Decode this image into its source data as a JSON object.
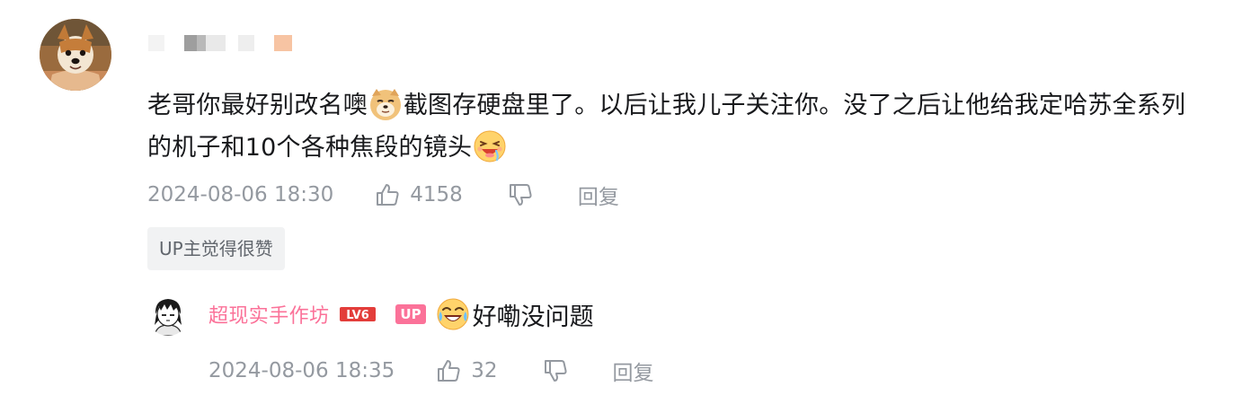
{
  "comment": {
    "text_part1": "老哥你最好别改名噢",
    "emoji1": "doge-emoji",
    "text_part2": "截图存硬盘里了。以后让我儿子关注你。没了之后让他给我定哈苏全系列的机子和10个各种焦段的镜头",
    "emoji2": "drooling-face-emoji",
    "timestamp": "2024-08-06 18:30",
    "like_count": "4158",
    "reply_label": "回复",
    "up_liked_tag": "UP主觉得很赞"
  },
  "reply": {
    "username": "超现实手作坊",
    "level_badge": "LV6",
    "up_badge": "UP",
    "emoji": "laughing-crying-emoji",
    "text": "好嘞没问题",
    "timestamp": "2024-08-06 18:35",
    "like_count": "32",
    "reply_label": "回复"
  },
  "colors": {
    "text_primary": "#18191c",
    "text_secondary": "#9499a0",
    "accent_pink": "#fb7299",
    "tag_background": "#f1f2f3",
    "level_badge_red": "#e33d3a"
  }
}
